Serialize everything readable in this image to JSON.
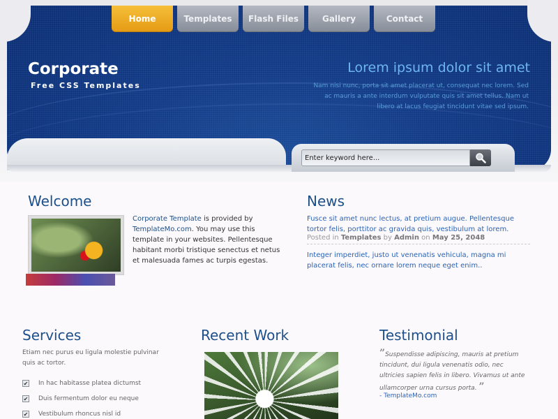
{
  "nav": {
    "items": [
      {
        "label": "Home",
        "active": true
      },
      {
        "label": "Templates",
        "active": false
      },
      {
        "label": "Flash Files",
        "active": false
      },
      {
        "label": "Gallery",
        "active": false
      },
      {
        "label": "Contact",
        "active": false
      }
    ]
  },
  "logo": {
    "title": "Corporate",
    "subtitle": "Free CSS Templates"
  },
  "header": {
    "title": "Lorem ipsum dolor sit amet",
    "text": "Nam nisi nunc, porta sit amet placerat ut, consequat nec lorem. Sed ac mauris a ante interdum vulputate quis sit amet tellus. Nam ut libero at lacus feugiat tincidunt vitae sed ipsum."
  },
  "search": {
    "placeholder": "Enter keyword here...",
    "button_icon": "magnifier-icon"
  },
  "welcome": {
    "heading": "Welcome",
    "link1": "Corporate Template",
    "text1": " is provided by ",
    "link2": "TemplateMo.com",
    "text2": ". You may use this template in your websites. Pellentesque habitant morbi tristique senectus et netus et malesuada fames ac turpis egestas."
  },
  "news": {
    "heading": "News",
    "item1": "Fusce sit amet nunc lectus, at pretium augue. Pellentesque tortor felis, porttitor ac gravida quis, vestibulum at lorem.",
    "meta_posted": "Posted in",
    "meta_category": "Templates",
    "meta_by": "by",
    "meta_author": "Admin",
    "meta_on": "on",
    "meta_date": "May 25, 2048",
    "item2": "Integer imperdiet, justo ut venenatis vehicula, magna mi placerat felis, nec ornare lorem neque eget enim.."
  },
  "services": {
    "heading": "Services",
    "text": "Etiam nec purus eu ligula molestie pulvinar quis ac tortor.",
    "items": [
      "In hac habitasse platea dictumst",
      "Duis fermentum dolor eu neque",
      "Vestibulum rhoncus nisl id"
    ]
  },
  "recent_work": {
    "heading": "Recent Work"
  },
  "testimonial": {
    "heading": "Testimonial",
    "open_quote": "”",
    "text": "Suspendisse adipiscing, mauris at pretium tincidunt, dui ligula venenatis odio, nec ultricies sapien felis in libero. Vivamus ut ante ullamcorper urna cursus porta.",
    "close_quote": "”",
    "author": "- TemplateMo.com"
  }
}
